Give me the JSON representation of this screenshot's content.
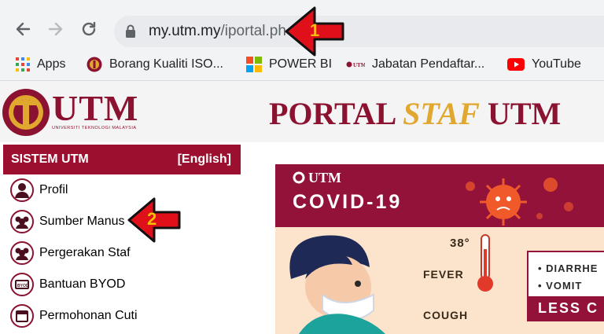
{
  "browser": {
    "url_domain": "my.utm.my",
    "url_path": "/iportal.ph",
    "bookmarks": [
      {
        "label": "Apps",
        "icon": "apps-grid-icon"
      },
      {
        "label": "Borang Kualiti ISO...",
        "icon": "utm-crest-icon"
      },
      {
        "label": "POWER BI",
        "icon": "windows-logo-icon"
      },
      {
        "label": "Jabatan Pendaftar...",
        "icon": "utm-small-logo-icon"
      },
      {
        "label": "YouTube",
        "icon": "youtube-icon"
      }
    ]
  },
  "header": {
    "logo_text": "UTM",
    "logo_subtitle": "UNIVERSITI TEKNOLOGI MALAYSIA",
    "title_part1": "PORTAL ",
    "title_part2": "STAF",
    "title_part3": " UTM"
  },
  "sidebar": {
    "heading": "SISTEM UTM",
    "language_link": "[English]",
    "items": [
      {
        "label": "Profil",
        "icon": "profile-icon"
      },
      {
        "label": "Sumber Manus",
        "icon": "group-icon"
      },
      {
        "label": "Pergerakan Staf",
        "icon": "group-icon"
      },
      {
        "label": "Bantuan BYOD",
        "icon": "byod-icon"
      },
      {
        "label": "Permohonan Cuti",
        "icon": "calendar-icon"
      }
    ]
  },
  "banner": {
    "brand": "UTM",
    "title": "COVID-19",
    "temperature": "38°",
    "symptom_fever": "FEVER",
    "symptom_cough": "COUGH",
    "list": [
      "• DIARRHE",
      "• VOMIT"
    ],
    "footer": "LESS C"
  },
  "annotations": [
    {
      "number": "1",
      "color": "#f2c200"
    },
    {
      "number": "2",
      "color": "#f2c200"
    }
  ],
  "colors": {
    "brand_maroon": "#8b1230",
    "sidebar_red": "#9c0f2e",
    "staf_gold": "#e0a82e"
  }
}
